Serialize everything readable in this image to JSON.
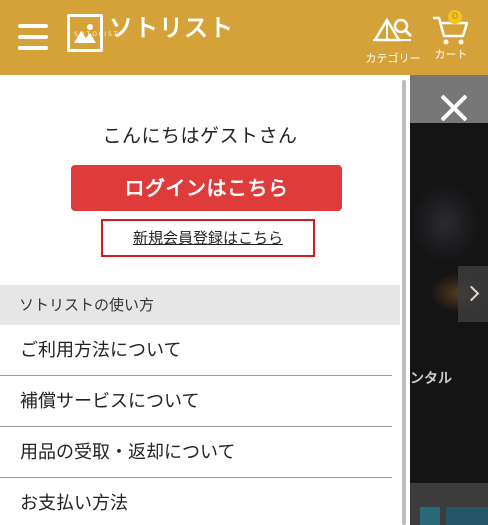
{
  "header": {
    "logo_text": "ソトリスト",
    "logo_sub": "SOTOLIST",
    "category_label": "カテゴリー",
    "cart_label": "カート",
    "cart_count": "0",
    "brand_color": "#d4a238"
  },
  "drawer": {
    "greeting": "こんにちはゲストさん",
    "login_button": "ログインはこちら",
    "register_link": "新規会員登録はこちら",
    "section_title": "ソトリストの使い方",
    "menu_items": [
      {
        "label": "ご利用方法について"
      },
      {
        "label": "補償サービスについて"
      },
      {
        "label": "用品の受取・返却について"
      },
      {
        "label": "お支払い方法"
      }
    ],
    "login_color": "#df3b3b"
  },
  "background": {
    "fragment_text": "ンタル"
  }
}
